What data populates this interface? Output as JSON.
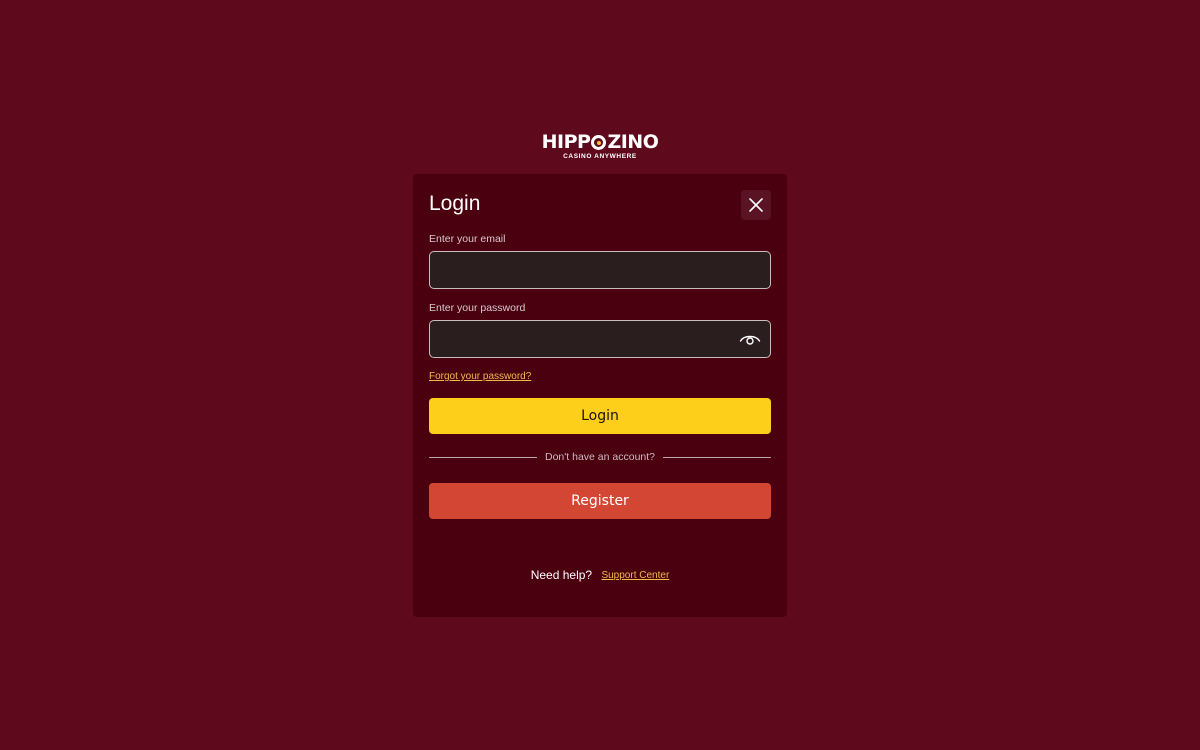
{
  "logo": {
    "word_left": "HIPP",
    "word_right": "ZINO",
    "tagline": "CASINO ANYWHERE"
  },
  "modal": {
    "title": "Login",
    "email_label": "Enter your email",
    "email_value": "",
    "password_label": "Enter your password",
    "password_value": "",
    "forgot_link": "Forgot your password?",
    "login_button": "Login",
    "divider_text": "Don't have an account?",
    "register_button": "Register",
    "help_text": "Need help?",
    "support_link": "Support Center"
  },
  "icons": {
    "close": "close-icon",
    "password_toggle": "eye-icon"
  },
  "colors": {
    "background": "#5e0a1c",
    "modal": "#4b0010",
    "login_button": "#fdcf1a",
    "register_button": "#d44634",
    "link": "#f0b94a"
  }
}
